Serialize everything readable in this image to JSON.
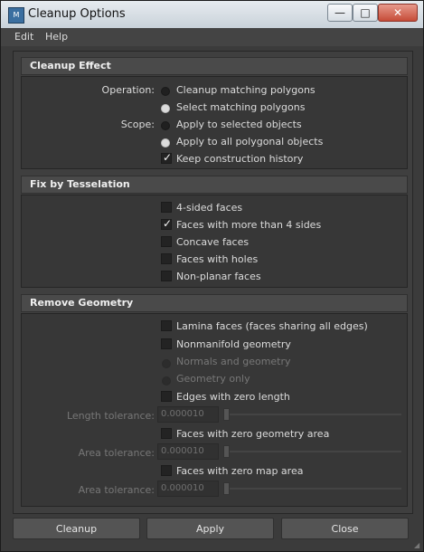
{
  "window": {
    "title": "Cleanup Options",
    "icon": "maya-app-icon",
    "controls": [
      "minimize-icon",
      "maximize-icon",
      "close-icon"
    ]
  },
  "menu": {
    "items": [
      "Edit",
      "Help"
    ]
  },
  "sections": {
    "cleanup_effect": {
      "title": "Cleanup Effect",
      "operation_label": "Operation:",
      "operation_options": [
        "Cleanup matching polygons",
        "Select matching polygons"
      ],
      "operation_selected": "Select matching polygons",
      "scope_label": "Scope:",
      "scope_options": [
        "Apply to selected objects",
        "Apply to all polygonal objects"
      ],
      "scope_selected": "Apply to all polygonal objects",
      "keep_history_label": "Keep construction history",
      "keep_history_checked": true
    },
    "fix_tesselation": {
      "title": "Fix by Tesselation",
      "options": [
        {
          "label": "4-sided faces",
          "checked": false
        },
        {
          "label": "Faces with more than 4 sides",
          "checked": true
        },
        {
          "label": "Concave faces",
          "checked": false
        },
        {
          "label": "Faces with holes",
          "checked": false
        },
        {
          "label": "Non-planar faces",
          "checked": false
        }
      ]
    },
    "remove_geometry": {
      "title": "Remove Geometry",
      "lamina_label": "Lamina faces (faces sharing all edges)",
      "lamina_checked": false,
      "nonmanifold_label": "Nonmanifold geometry",
      "nonmanifold_checked": false,
      "nonmanifold_options": [
        "Normals and geometry",
        "Geometry only"
      ],
      "nonmanifold_selected": "Normals and geometry",
      "edges_zero_label": "Edges with zero length",
      "edges_zero_checked": false,
      "length_tolerance_label": "Length tolerance:",
      "length_tolerance_value": "0.000010",
      "faces_zero_geo_label": "Faces with zero geometry area",
      "faces_zero_geo_checked": false,
      "area_tolerance_label": "Area tolerance:",
      "area_tolerance_value": "0.000010",
      "faces_zero_map_label": "Faces with zero map area",
      "faces_zero_map_checked": false,
      "map_area_tolerance_label": "Area tolerance:",
      "map_area_tolerance_value": "0.000010"
    }
  },
  "buttons": {
    "cleanup": "Cleanup",
    "apply": "Apply",
    "close": "Close"
  },
  "colors": {
    "panel_bg": "#3f3f3f",
    "header_bg": "#4a4a4a",
    "body_bg": "#373737",
    "text": "#dcdcdc",
    "disabled_text": "#777777",
    "titlebar_close": "#c64c38"
  }
}
